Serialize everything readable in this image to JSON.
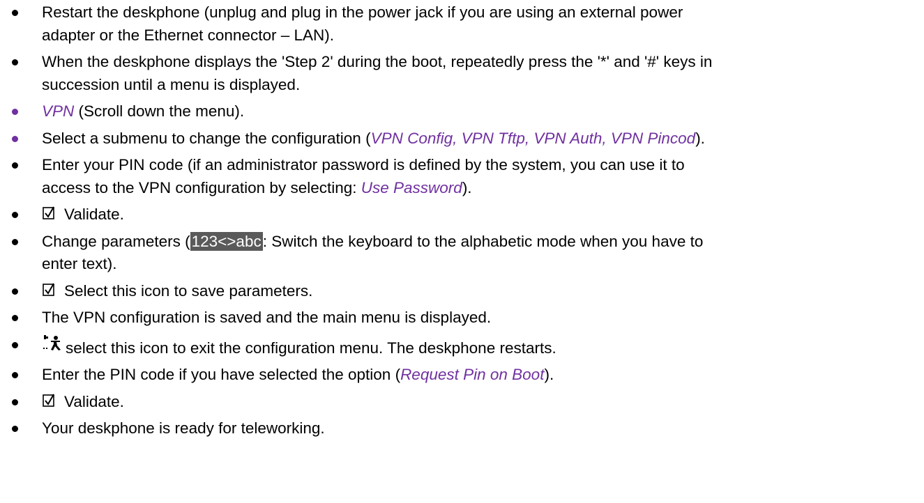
{
  "steps": [
    {
      "id": "restart",
      "parts": [
        {
          "t": "Restart the deskphone (unplug and plug in the power jack if you are using an external power adapter or the Ethernet connector – LAN)."
        }
      ]
    },
    {
      "id": "boot",
      "parts": [
        {
          "t": "When the deskphone displays the 'Step 2' during the boot, repeatedly press the '*' and '#' keys in succession until a menu is displayed."
        }
      ]
    }
  ],
  "step1": "Restart the deskphone (unplug and plug in the power jack if you are using an external power",
  "step1b": "adapter or the Ethernet connector – LAN).",
  "step2": "When the deskphone displays the 'Step 2' during the boot, repeatedly press the '*' and '#' keys in",
  "step2b": "succession until a menu is displayed.",
  "step3_italic": "VPN",
  "step3_rest": " (Scroll down the menu).",
  "step4_pre": "Select a submenu to change the configuration (",
  "step4_italic": "VPN Config, VPN Tftp, VPN Auth, VPN Pincod",
  "step4_post": ").",
  "step5": "Enter your PIN code (if an administrator password is defined by the system, you can use it to",
  "step5b_pre": "access to the VPN configuration by selecting: ",
  "step5b_italic": "Use Password",
  "step5b_post": ").",
  "step6": "Validate.",
  "step7_pre": "Change parameters (",
  "step7_badge": "123<>abc",
  "step7_post": ": Switch the keyboard to the alphabetic mode when you have to",
  "step7b": "enter text).",
  "step8": "Select this icon to save parameters.",
  "step9": "The VPN configuration is saved and the main menu is displayed.",
  "step10": "select this icon to exit the configuration menu. The deskphone restarts.",
  "step11_pre": "Enter the PIN code if you have selected the option (",
  "step11_italic": "Request Pin on Boot",
  "step11_post": ").",
  "step12": "Validate.",
  "step13": "Your deskphone is ready for teleworking.",
  "icons": {
    "validate": "checkbox-check-icon",
    "exit": "exit-running-man-icon"
  },
  "colors": {
    "accent": "#7030a0",
    "badge_bg": "#5a5a5a",
    "text": "#000000"
  }
}
